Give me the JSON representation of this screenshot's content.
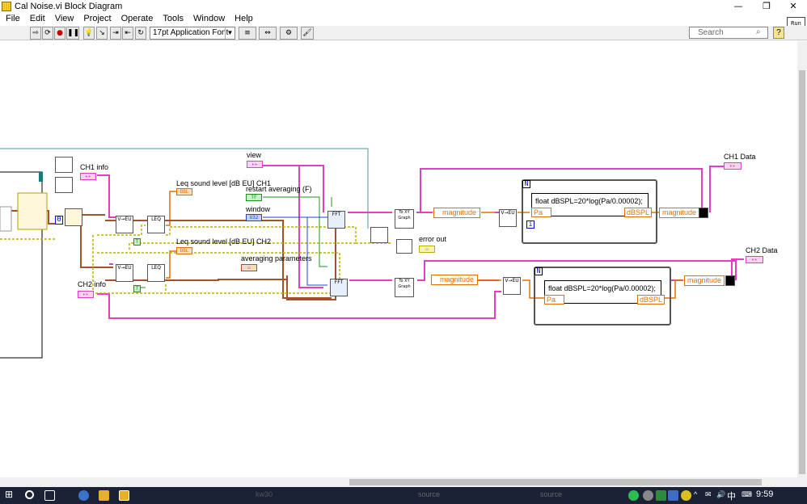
{
  "window": {
    "title": "Cal Noise.vi Block Diagram",
    "min_glyph": "—",
    "restore_glyph": "❐",
    "close_glyph": "✕"
  },
  "menu": [
    "File",
    "Edit",
    "View",
    "Project",
    "Operate",
    "Tools",
    "Window",
    "Help"
  ],
  "toolbar": {
    "font_label": "17pt Application Font",
    "search_placeholder": "Search",
    "help_label": "?",
    "run_fft_label": "Run FFT",
    "buttons": [
      "⇨",
      "⟳",
      "●",
      "❚❚",
      "💡",
      "↘",
      "⇥",
      "⇤",
      "↻",
      "≡",
      "⇔",
      "⚙",
      "🖌"
    ]
  },
  "diagram": {
    "labels": {
      "ch1_info": "CH1 info",
      "ch2_info": "CH2 info",
      "leq_ch1": "Leq sound level [dB EU] CH1",
      "leq_ch2": "Leq sound level [dB EU] CH2",
      "view": "view",
      "restart": "restart averaging (F)",
      "window": "window",
      "avg_params": "averaging parameters",
      "error_out": "error out",
      "ch1_data": "CH1 Data",
      "ch2_data": "CH2 Data",
      "magnitude": "magnitude",
      "formula": "float dBSPL=20*log(Pa/0.00002);",
      "pa": "Pa",
      "dbspl": "dBSPL",
      "to_graph": "To XY Graph",
      "fft": "FFT",
      "leq": "LEQ",
      "v_eu": "V→EU",
      "const_zero": "0",
      "loop_n": "N",
      "loop_i": "i"
    },
    "colors": {
      "pink": "#e040c0",
      "orange": "#e07000",
      "brown": "#a0522d",
      "olive": "#b8b000",
      "green": "#209020",
      "teal": "#3c9c9c",
      "blue": "#2040e0"
    }
  },
  "taskbar": {
    "time": "9:59",
    "items": [
      "source",
      "source",
      "kw30"
    ],
    "ime": "中"
  }
}
